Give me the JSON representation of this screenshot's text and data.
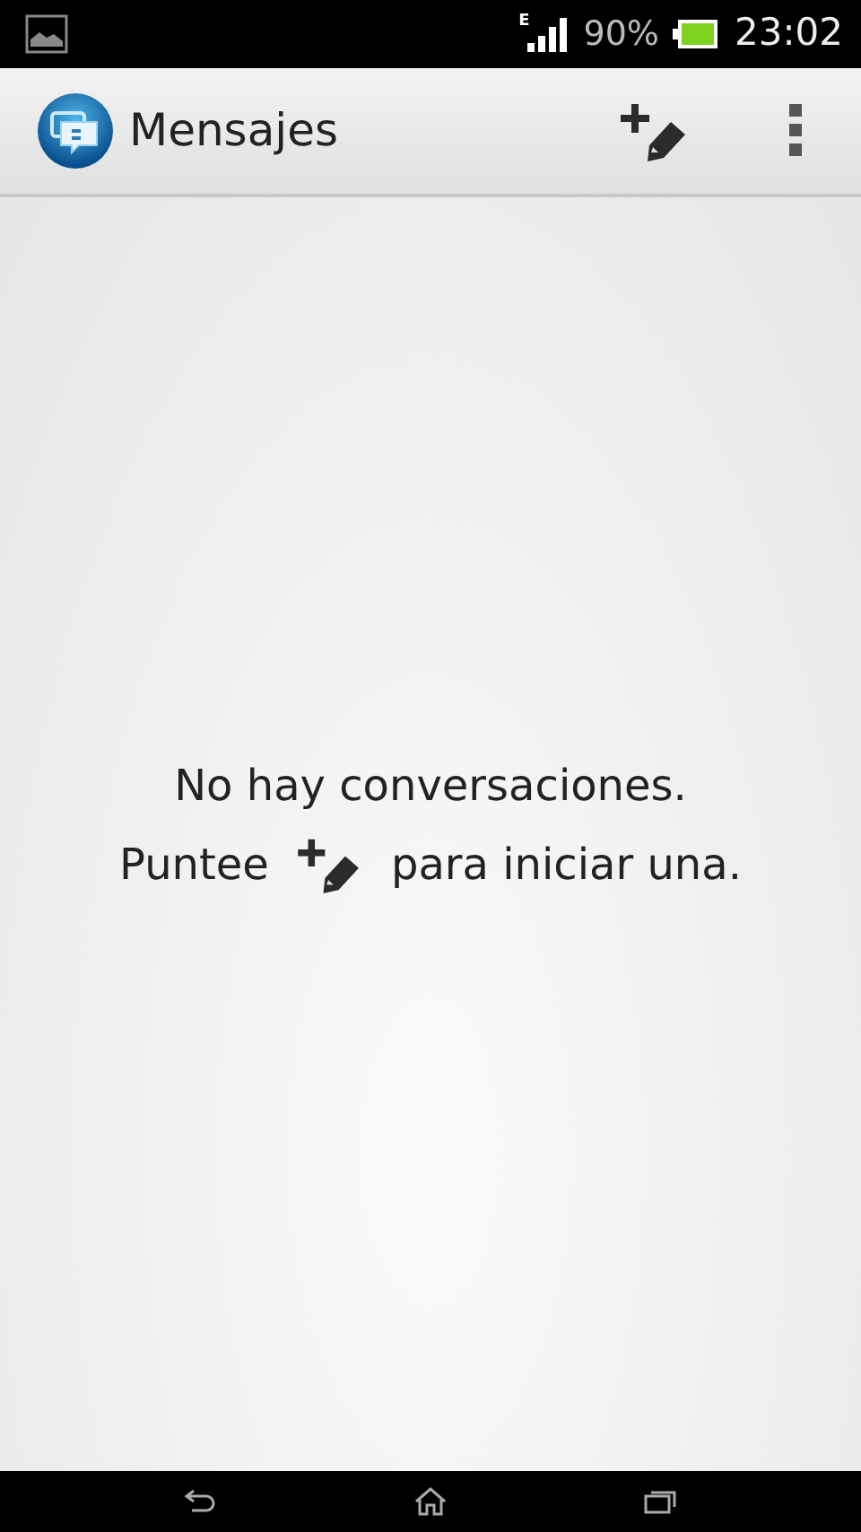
{
  "status_bar": {
    "signal_type": "E",
    "battery_percent": "90%",
    "time": "23:02"
  },
  "action_bar": {
    "title": "Mensajes"
  },
  "empty_state": {
    "message": "No hay conversaciones.",
    "hint_before": "Puntee",
    "hint_after": "para iniciar una."
  }
}
